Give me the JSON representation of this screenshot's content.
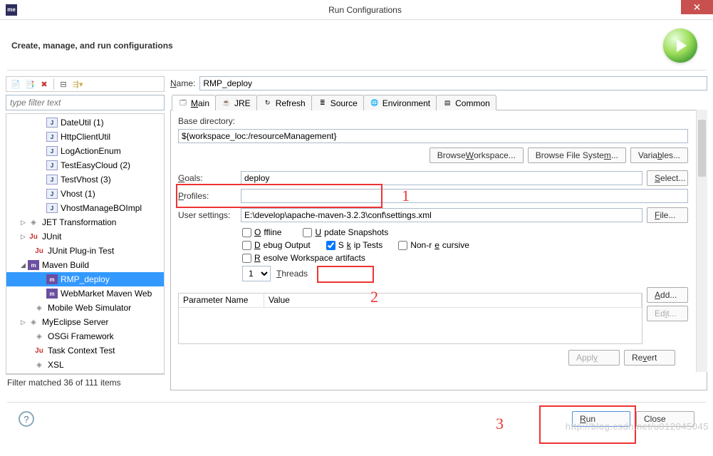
{
  "window": {
    "title": "Run Configurations"
  },
  "header": {
    "title": "Create, manage, and run configurations"
  },
  "filter": {
    "placeholder": "type filter text",
    "status": "Filter matched 36 of 111 items"
  },
  "tree": {
    "items": [
      {
        "label": "DateUtil (1)",
        "kind": "j",
        "lvl": 1
      },
      {
        "label": "HttpClientUtil",
        "kind": "j",
        "lvl": 1
      },
      {
        "label": "LogActionEnum",
        "kind": "j",
        "lvl": 1
      },
      {
        "label": "TestEasyCloud (2)",
        "kind": "j",
        "lvl": 1
      },
      {
        "label": "TestVhost (3)",
        "kind": "j",
        "lvl": 1
      },
      {
        "label": "Vhost (1)",
        "kind": "j",
        "lvl": 1
      },
      {
        "label": "VhostManageBOImpl",
        "kind": "j",
        "lvl": 1
      },
      {
        "label": "JET Transformation",
        "kind": "gen",
        "lvl": 0,
        "exp": "▷"
      },
      {
        "label": "JUnit",
        "kind": "ju",
        "lvl": 0,
        "exp": "▷"
      },
      {
        "label": "JUnit Plug-in Test",
        "kind": "ju",
        "lvl": 0
      },
      {
        "label": "Maven Build",
        "kind": "m",
        "lvl": 0,
        "exp": "◢"
      },
      {
        "label": "RMP_deploy",
        "kind": "m",
        "lvl": 1,
        "sel": true
      },
      {
        "label": "WebMarket Maven Web",
        "kind": "m",
        "lvl": 1
      },
      {
        "label": "Mobile Web Simulator",
        "kind": "gen",
        "lvl": 0
      },
      {
        "label": "MyEclipse Server",
        "kind": "gen",
        "lvl": 0,
        "exp": "▷"
      },
      {
        "label": "OSGi Framework",
        "kind": "gen",
        "lvl": 0
      },
      {
        "label": "Task Context Test",
        "kind": "ju",
        "lvl": 0
      },
      {
        "label": "XSL",
        "kind": "gen",
        "lvl": 0
      }
    ]
  },
  "name": {
    "label": "Name:",
    "value": "RMP_deploy"
  },
  "tabs": [
    "Main",
    "JRE",
    "Refresh",
    "Source",
    "Environment",
    "Common"
  ],
  "form": {
    "base_dir_label": "Base directory:",
    "base_dir_value": "${workspace_loc:/resourceManagement}",
    "browse_ws": "Browse Workspace...",
    "browse_fs": "Browse File System...",
    "variables": "Variables...",
    "goals_label": "Goals:",
    "goals_value": "deploy",
    "select": "Select...",
    "profiles_label": "Profiles:",
    "profiles_value": "",
    "user_settings_label": "User settings:",
    "user_settings_value": "E:\\develop\\apache-maven-3.2.3\\conf\\settings.xml",
    "file": "File...",
    "offline": "Offline",
    "update_snapshots": "Update Snapshots",
    "debug_output": "Debug Output",
    "skip_tests": "Skip Tests",
    "non_recursive": "Non-recursive",
    "resolve_ws": "Resolve Workspace artifacts",
    "threads": "Threads",
    "threads_value": "1",
    "col_param": "Parameter Name",
    "col_value": "Value",
    "add": "Add...",
    "edit": "Edit...",
    "apply": "Apply",
    "revert": "Revert"
  },
  "bottom": {
    "run": "Run",
    "close": "Close"
  },
  "annot": {
    "one": "1",
    "two": "2",
    "three": "3"
  },
  "watermark": "http://blog.csdn.net/u012045045"
}
